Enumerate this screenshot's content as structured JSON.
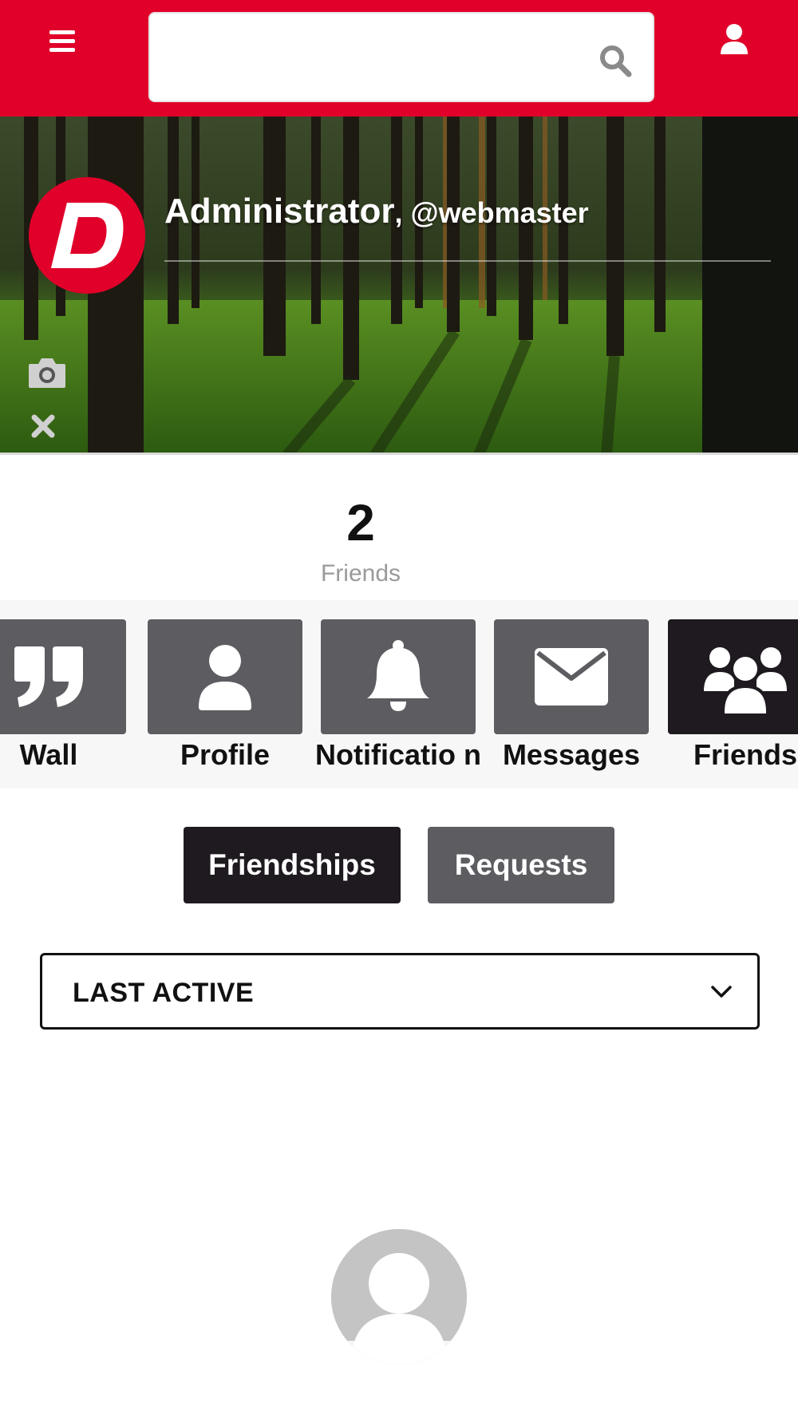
{
  "header": {
    "menu_icon": "hamburger-menu-icon",
    "search_placeholder": "",
    "search_icon": "search-icon",
    "user_icon": "user-icon",
    "brand_color": "#e0002a"
  },
  "profile": {
    "name": "Administrator",
    "handle": ", @webmaster",
    "avatar_letter": "D",
    "camera_icon": "camera-icon",
    "close_icon": "close-icon"
  },
  "stats": {
    "friends_count": "2",
    "friends_label": "Friends"
  },
  "nav": {
    "items": [
      {
        "label": "Wall",
        "icon": "quote-icon"
      },
      {
        "label": "Profile",
        "icon": "user-icon"
      },
      {
        "label": "Notificatio ns",
        "icon": "bell-icon"
      },
      {
        "label": "Messages",
        "icon": "envelope-icon"
      },
      {
        "label": "Friends",
        "icon": "users-icon",
        "active": true
      }
    ],
    "tile_color": "#5d5c61",
    "active_color": "#1e1a1f"
  },
  "tabs": {
    "friendships": "Friendships",
    "requests": "Requests"
  },
  "sort": {
    "selected": "LAST ACTIVE"
  },
  "friends_list": {
    "placeholder_icon": "default-avatar-icon"
  }
}
